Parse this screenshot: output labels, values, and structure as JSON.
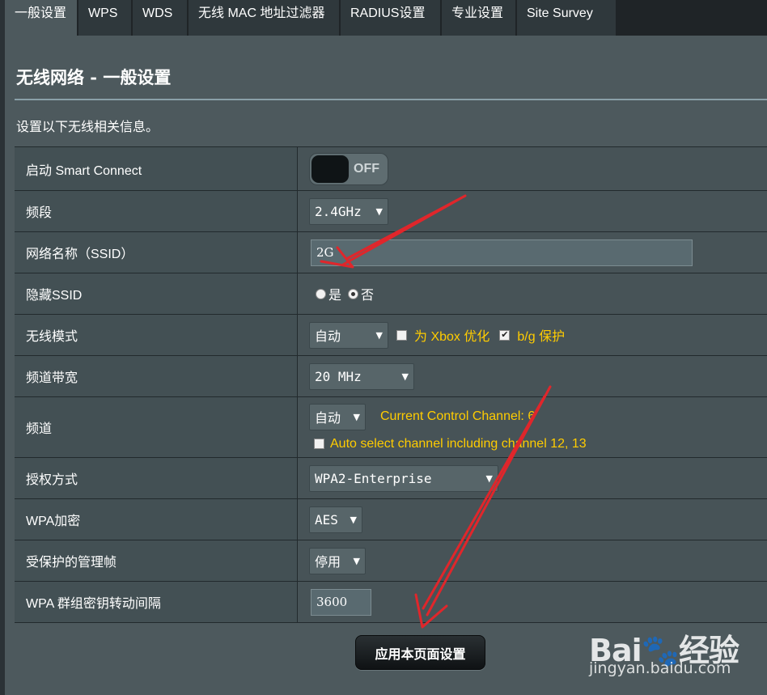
{
  "tabs": [
    {
      "label": "一般设置",
      "active": true
    },
    {
      "label": "WPS"
    },
    {
      "label": "WDS"
    },
    {
      "label": "无线 MAC 地址过滤器"
    },
    {
      "label": "RADIUS设置"
    },
    {
      "label": "专业设置"
    },
    {
      "label": "Site Survey"
    }
  ],
  "page": {
    "title": "无线网络 - 一般设置",
    "description": "设置以下无线相关信息。"
  },
  "rows": {
    "smart_connect": {
      "label": "启动 Smart Connect",
      "toggle_text": "OFF"
    },
    "band": {
      "label": "频段",
      "value": "2.4GHz"
    },
    "ssid": {
      "label": "网络名称（SSID）",
      "value": "2G"
    },
    "hide_ssid": {
      "label": "隐藏SSID",
      "yes": "是",
      "no": "否",
      "selected": "no"
    },
    "wireless_mode": {
      "label": "无线模式",
      "value": "自动",
      "xbox_label": "为 Xbox 优化",
      "bg_label": "b/g 保护"
    },
    "bandwidth": {
      "label": "频道带宽",
      "value": "20 MHz"
    },
    "channel": {
      "label": "频道",
      "value": "自动",
      "current": "Current Control Channel: 6",
      "auto_select": "Auto select channel including channel 12, 13"
    },
    "auth": {
      "label": "授权方式",
      "value": "WPA2-Enterprise"
    },
    "wpa_enc": {
      "label": "WPA加密",
      "value": "AES"
    },
    "pmf": {
      "label": "受保护的管理帧",
      "value": "停用"
    },
    "gtk": {
      "label": "WPA 群组密钥转动间隔",
      "value": "3600"
    }
  },
  "apply_label": "应用本页面设置",
  "watermark": {
    "brand": "Bai",
    "brand2": "经验",
    "url": "jingyan.baidu.com"
  },
  "colors": {
    "accent_yellow": "#ffcc00",
    "annotation_red": "#e0262b"
  }
}
